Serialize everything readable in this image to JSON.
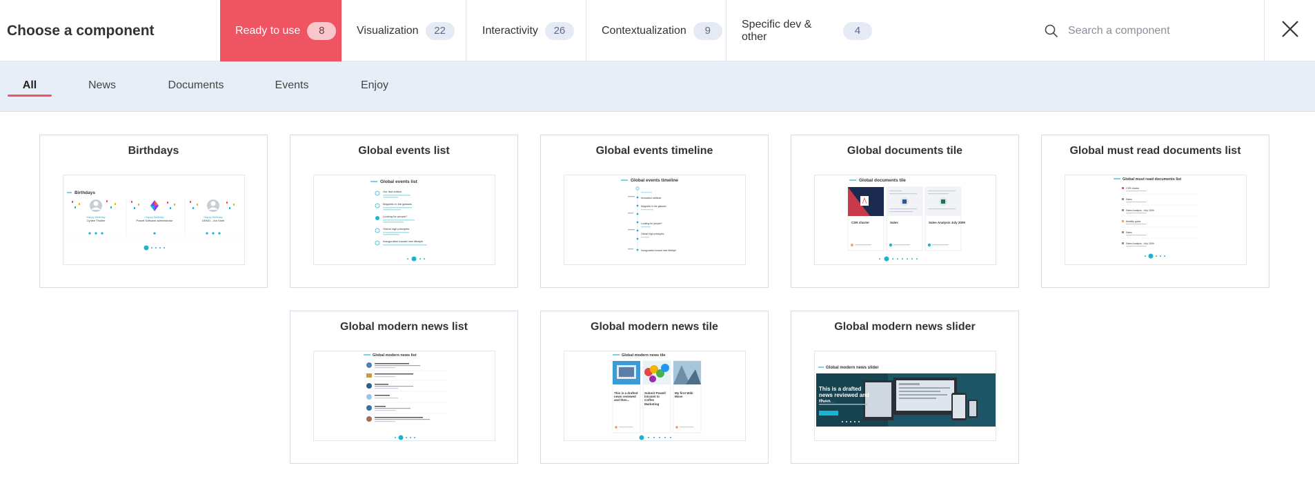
{
  "header": {
    "title": "Choose a component",
    "tabs": [
      {
        "label": "Ready to use",
        "count": "8"
      },
      {
        "label": "Visualization",
        "count": "22"
      },
      {
        "label": "Interactivity",
        "count": "26"
      },
      {
        "label": "Contextualization",
        "count": "9"
      },
      {
        "label": "Specific dev & other",
        "count": "4"
      }
    ],
    "active_tab": 0,
    "search": {
      "placeholder": "Search a component",
      "value": ""
    }
  },
  "subnav": {
    "items": [
      {
        "label": "All"
      },
      {
        "label": "News"
      },
      {
        "label": "Documents"
      },
      {
        "label": "Events"
      },
      {
        "label": "Enjoy"
      }
    ],
    "active": 0
  },
  "components": [
    {
      "title": "Birthdays",
      "preview": {
        "heading": "Birthdays",
        "people": [
          {
            "greeting": "Happy Birthday",
            "name": "Cyrilee Thoilier"
          },
          {
            "greeting": "Happy Birthday",
            "name": "Powell Software administrator"
          },
          {
            "greeting": "Happy Birthday",
            "name": "DEMO - Jon Snell"
          }
        ]
      }
    },
    {
      "title": "Global events list",
      "preview": {
        "heading": "Global events list",
        "items": [
          "Our first edition",
          "Magnetic in the glasses",
          "Looking for people?",
          "Global high principles",
          "Inauguration toward new lifestyle"
        ]
      }
    },
    {
      "title": "Global events timeline",
      "preview": {
        "heading": "Global events timeline",
        "items": [
          "Innovation webinar",
          "Magnetic in the glasses",
          "Looking for people?",
          "Global high principles",
          "Inauguration toward new lifestyle"
        ]
      }
    },
    {
      "title": "Global documents tile",
      "preview": {
        "heading": "Global documents tile",
        "docs": [
          "CSR charter",
          "Sales",
          "Sales Analysis July 2009"
        ]
      }
    },
    {
      "title": "Global must read documents list",
      "preview": {
        "heading": "Global must read documents list",
        "items": [
          "CSR charter",
          "Sales",
          "Sales Analysis - July 2009",
          "Mobility guide",
          "Sales",
          "Sales Analysis - July 2009"
        ]
      }
    },
    {
      "title": "Global modern news list",
      "preview": {
        "heading": "Global modern news list"
      }
    },
    {
      "title": "Global modern news tile",
      "preview": {
        "heading": "Global modern news tile",
        "tiles": [
          "This is a drafted news reviewed and then...",
          "Submit Powell Intranet to Coffee Marketing",
          "My first Wiki Move"
        ]
      }
    },
    {
      "title": "Global modern news slider",
      "preview": {
        "heading": "Global modern news slider",
        "headline": "This is a drafted news reviewed and then..."
      }
    }
  ],
  "colors": {
    "accent": "#ef5462",
    "teal": "#19b5d0",
    "badge_bg": "#e5eaf4",
    "subnav_bg": "#e8eef8"
  }
}
